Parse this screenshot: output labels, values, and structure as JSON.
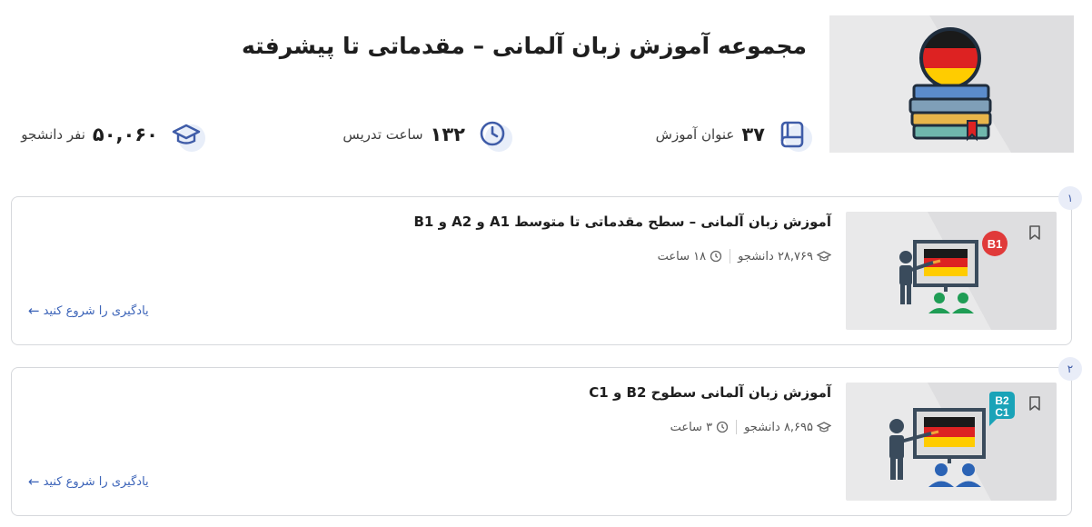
{
  "header": {
    "title": "مجموعه آموزش زبان آلمانی – مقدماتی تا پیشرفته",
    "hero_image_icon": "german-books-icon"
  },
  "stats": {
    "courses": {
      "value": "۳۷",
      "label": "عنوان آموزش",
      "icon": "book-icon"
    },
    "hours": {
      "value": "۱۳۲",
      "label": "ساعت تدریس",
      "icon": "clock-icon"
    },
    "students": {
      "value": "۵۰,۰۶۰",
      "label": "نفر دانشجو",
      "icon": "graduation-cap-icon"
    }
  },
  "courses": [
    {
      "index": "۱",
      "title": "آموزش زبان آلمانی – سطح مقدماتی تا متوسط A1 و A2 و B1",
      "students": "۲۸,۷۶۹ دانشجو",
      "hours": "۱۸ ساعت",
      "level_badge": "B1",
      "level_color": "#e03a3a",
      "start_label": "یادگیری را شروع کنید"
    },
    {
      "index": "۲",
      "title": "آموزش زبان آلمانی سطوح B2 و C1",
      "students": "۸,۶۹۵ دانشجو",
      "hours": "۳ ساعت",
      "level_badge_line1": "B2",
      "level_badge_line2": "C1",
      "level_color": "#1aa3b8",
      "start_label": "یادگیری را شروع کنید"
    }
  ],
  "colors": {
    "accent": "#3b63b8",
    "icon_blue": "#3f5ca8",
    "icon_bg": "#e8eef9",
    "card_border": "#d6d8dc",
    "thumb_bg": "#e9e9ea"
  }
}
